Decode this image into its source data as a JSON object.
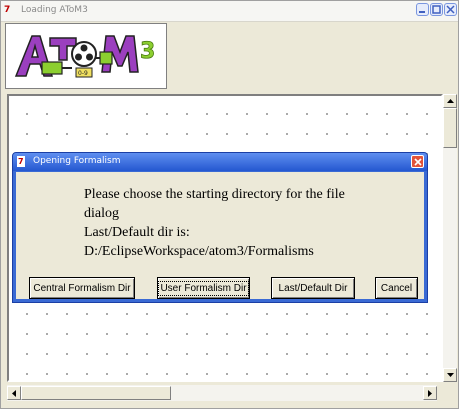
{
  "window": {
    "title": "Loading AToM3",
    "app_icon": "7",
    "controls": [
      "minimize-icon",
      "maximize-icon",
      "close-icon"
    ]
  },
  "logo": {
    "text": "AToM3"
  },
  "dialog": {
    "title": "Opening Formalism",
    "app_icon": "7",
    "message": "Please choose the starting directory for the file\ndialog\nLast/Default dir is:\nD:/EclipseWorkspace/atom3/Formalisms",
    "buttons": {
      "central": "Central Formalism Dir",
      "user": "User Formalism Dir",
      "last_default": "Last/Default Dir",
      "cancel": "Cancel"
    },
    "focused_button": "user"
  },
  "colors": {
    "dialog_titlebar": "#2457d0",
    "logo_purple": "#9b3fbf",
    "logo_green": "#8ccf30"
  }
}
